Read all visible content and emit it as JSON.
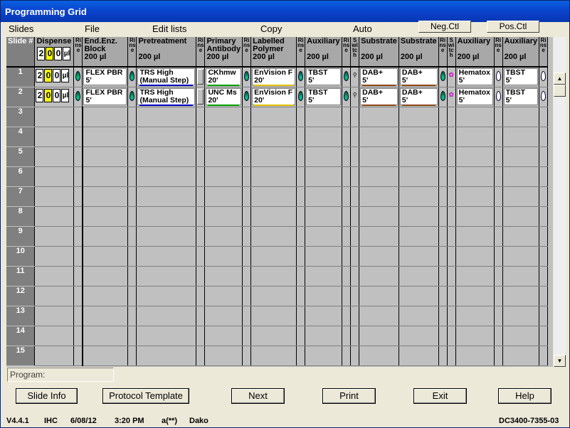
{
  "window": {
    "title": "Programming Grid"
  },
  "menu": {
    "slides": "Slides",
    "file": "File",
    "edit_lists": "Edit lists",
    "copy": "Copy",
    "auto": "Auto",
    "neg_ctl": "Neg.Ctl",
    "pos_ctl": "Pos.Ctl"
  },
  "grid": {
    "headers": {
      "slide": "Slide #",
      "dispense": "Dispense",
      "end_enz": "End.Enz. Block",
      "end_enz_vol": "200 µl",
      "rinse": "Rinse",
      "pretreatment": "Pretreatment",
      "pretreatment_vol": "200 µl",
      "primary": "Primary Antibody",
      "primary_vol": "200 µl",
      "labelled": "Labelled Polymer",
      "labelled_vol": "200 µl",
      "aux1": "Auxiliary",
      "aux1_vol": "200 µl",
      "switch": "Switch",
      "sub1": "Substrate",
      "sub1_vol": "200 µl",
      "sub2": "Substrate",
      "sub2_vol": "200 µl",
      "aux2": "Auxiliary",
      "aux2_vol": "200 µl",
      "aux3": "Auxiliary",
      "aux3_vol": "200 µl"
    },
    "dispense_header": {
      "d1": "2",
      "d2": "0",
      "d3": "0",
      "unit": "µl"
    },
    "rows": [
      {
        "num": "1",
        "disp": {
          "d1": "2",
          "d2": "0",
          "d3": "0",
          "unit": "µl"
        },
        "end_enz": {
          "a": "FLEX PBR",
          "b": "5'"
        },
        "pretreat": {
          "a": "TRS High",
          "b": "(Manual Step)"
        },
        "primary": {
          "a": "CKhmw",
          "b": "20'"
        },
        "labelled": {
          "a": "EnVision F",
          "b": "20'"
        },
        "aux1": {
          "a": "TBST",
          "b": "5'"
        },
        "sub1": {
          "a": "DAB+",
          "b": "5'"
        },
        "sub2": {
          "a": "DAB+",
          "b": "5'"
        },
        "aux2": {
          "a": "Hematox",
          "b": "5'"
        },
        "aux3": {
          "a": "TBST",
          "b": "5'"
        }
      },
      {
        "num": "2",
        "disp": {
          "d1": "2",
          "d2": "0",
          "d3": "0",
          "unit": "µl"
        },
        "end_enz": {
          "a": "FLEX PBR",
          "b": "5'"
        },
        "pretreat": {
          "a": "TRS High",
          "b": "(Manual Step)"
        },
        "primary": {
          "a": "UNC Ms",
          "b": "20'"
        },
        "labelled": {
          "a": "EnVision F",
          "b": "20'"
        },
        "aux1": {
          "a": "TBST",
          "b": "5'"
        },
        "sub1": {
          "a": "DAB+",
          "b": "5'"
        },
        "sub2": {
          "a": "DAB+",
          "b": "5'"
        },
        "aux2": {
          "a": "Hematox",
          "b": "5'"
        },
        "aux3": {
          "a": "TBST",
          "b": "5'"
        }
      }
    ],
    "empty_rows": [
      "3",
      "4",
      "5",
      "6",
      "7",
      "8",
      "9",
      "10",
      "11",
      "12",
      "13",
      "14",
      "15"
    ]
  },
  "program_label": "Program:",
  "buttons": {
    "slide_info": "Slide Info",
    "protocol_template": "Protocol Template",
    "next": "Next",
    "print": "Print",
    "exit": "Exit",
    "help": "Help"
  },
  "status": {
    "version": "V4.4.1",
    "mode": "IHC",
    "date": "6/08/12",
    "time": "3:20 PM",
    "user": "a(**)",
    "vendor": "Dako",
    "device": "DC3400-7355-03"
  },
  "colors": {
    "primary_ckhmw_line": "#00a000",
    "primary_unc_line": "#00a000",
    "labelled_line": "#e0c000",
    "pretreat_line": "#0000c0",
    "dab_line": "#8b4513"
  }
}
